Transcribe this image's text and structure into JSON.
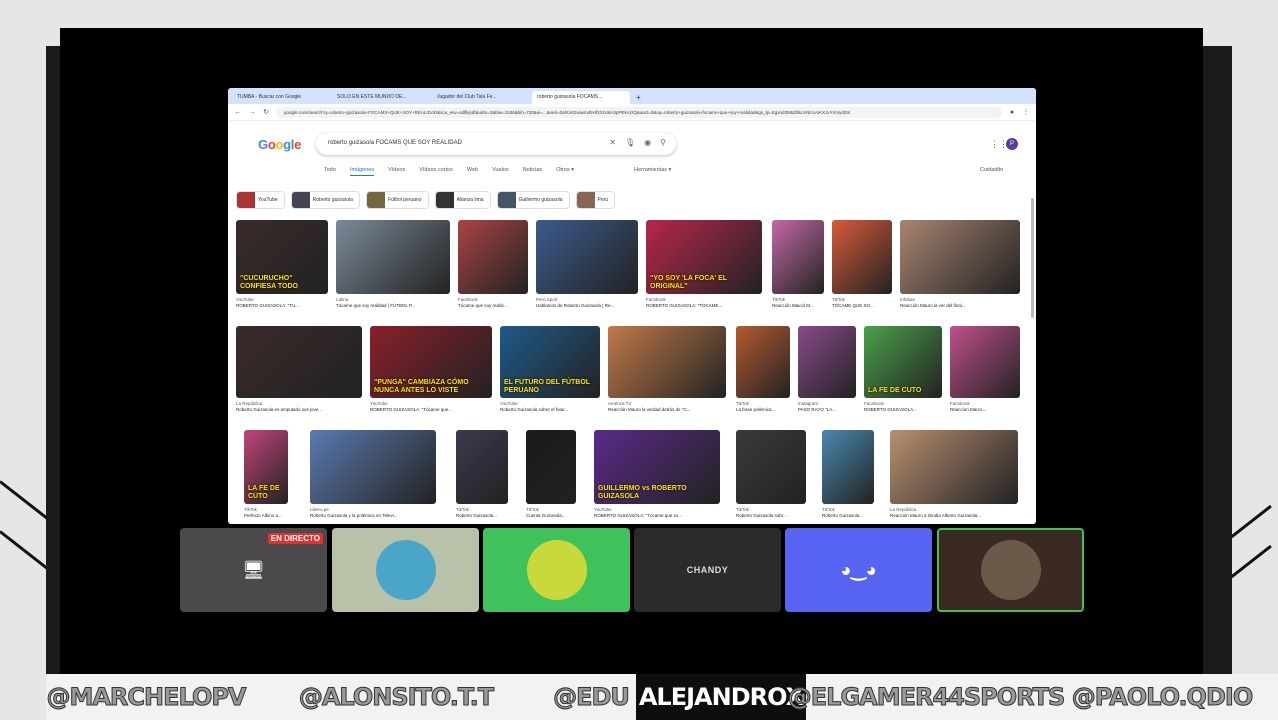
{
  "browser": {
    "tabs": [
      {
        "label": "TUMBA - Buscar con Google",
        "active": false
      },
      {
        "label": "SOLO EN ESTE MUNDO DE...",
        "active": false
      },
      {
        "label": "Jugador del Club Tala Fe...",
        "active": false
      },
      {
        "label": "roberto guizasola FOCAMS...",
        "active": true
      }
    ],
    "url": "google.com/search?q=roberto+guizasola+FOCAMS+QUE+SOY+REALIDAD&sca_esv=sdlfkjsdf&udm=2&biw=1536&bih=730&ei=...&ved=0ahUKEwiwmd5Hf2h3U6A3pPEkAOQ&uact=5&oq=roberto+guizasola+focams+que+soy+realidad&gs_lp=Egxnd3Mtd2l6LXNlcnAiKXJvYmVydG8",
    "tab_plus": "+"
  },
  "google": {
    "logo": [
      "G",
      "o",
      "o",
      "g",
      "l",
      "e"
    ],
    "logo_colors": [
      "#4285f4",
      "#ea4335",
      "#fbbc05",
      "#4285f4",
      "#34a853",
      "#ea4335"
    ],
    "query": "roberto guizasola FOCAMS QUE SOY REALIDAD",
    "tabs": [
      "Todo",
      "Imágenes",
      "Vídeos",
      "Vídeos cortos",
      "Web",
      "Vuelos",
      "Noticias",
      "Otros ▾"
    ],
    "tools": "Herramientas ▾",
    "safe_search": "Cuidadito",
    "avatar_letter": "P",
    "chips": [
      {
        "label": "YouTube",
        "color": "#a33"
      },
      {
        "label": "Roberto guizasola",
        "color": "#445"
      },
      {
        "label": "Fútbol peruano",
        "color": "#764"
      },
      {
        "label": "Alianza lima",
        "color": "#333"
      },
      {
        "label": "Guillermo guizasola",
        "color": "#456"
      },
      {
        "label": "Perú",
        "color": "#865"
      }
    ]
  },
  "results": {
    "row1": [
      {
        "src": "YouTube",
        "title": "ROBERTO GUIZASOLA: \"TU...",
        "caption": "\"CUCURUCHO\" CONFIESA TODO",
        "color": "#3a2b2b"
      },
      {
        "src": "Latina",
        "title": "Tócame que soy realidad | FÚTBOL P...",
        "caption": "",
        "color": "#7b8a99"
      },
      {
        "src": "Facebook",
        "title": "Tócame que soy realid...",
        "caption": "",
        "color": "#a44"
      },
      {
        "src": "Perú Sport",
        "title": "Hablamos de Roberto Guizasola | Re...",
        "caption": "",
        "color": "#3b5b8c"
      },
      {
        "src": "Facebook",
        "title": "ROBERTO GUIZASOLA: \"TÓCAME...",
        "caption": "\"YO SOY 'LA FOCA' EL ORIGINAL\"",
        "color": "#b7264b"
      },
      {
        "src": "TikTok",
        "title": "Reacción Maicol M...",
        "caption": "",
        "color": "#c46aa8"
      },
      {
        "src": "TikTok",
        "title": "TÓCAME QUE SO...",
        "caption": "",
        "color": "#d85a3a"
      },
      {
        "src": "Infobae",
        "title": "Reacción Mauro la ver del final...",
        "caption": "",
        "color": "#a88570"
      }
    ],
    "row2": [
      {
        "src": "La República",
        "title": "Roberto Guizasola es amputado sus jove...",
        "caption": "",
        "color": "#3a2a2a"
      },
      {
        "src": "YouTube",
        "title": "ROBERTO GUIZASOLA: \"Tócame que...",
        "caption": "\"PUNGA\" CAMBIAZA CÓMO NUNCA ANTES LO VISTE",
        "color": "#8a1f2a"
      },
      {
        "src": "YouTube",
        "title": "Roberto Guizasola sobre el futur...",
        "caption": "EL FUTURO DEL FÚTBOL PERUANO",
        "color": "#1f5a88"
      },
      {
        "src": "América TV",
        "title": "Reacción Mauro la verdad detrás de \"C...",
        "caption": "",
        "color": "#c27a4a"
      },
      {
        "src": "TikTok",
        "title": "La frase polémica...",
        "caption": "",
        "color": "#b55a30"
      },
      {
        "src": "Instagram",
        "title": "PASO RAYO \"LA...",
        "caption": "",
        "color": "#8a4a8c"
      },
      {
        "src": "Facebook",
        "title": "ROBERTO GUIZASOLA...",
        "caption": "LA FE DE CUTO",
        "color": "#4aa04a"
      },
      {
        "src": "Facebook",
        "title": "Reaccion Marco...",
        "caption": "",
        "color": "#c0508c"
      }
    ],
    "row3": [
      {
        "src": "TikTok",
        "title": "Perfecto Albino a...",
        "caption": "LA FE DE CUTO",
        "color": "#c2457a"
      },
      {
        "src": "Libero.pe",
        "title": "Roberto Guizasola y la polémica en Televi...",
        "caption": "",
        "color": "#5a7ab0"
      },
      {
        "src": "TikTok",
        "title": "Roberto Guizasola...",
        "caption": "",
        "color": "#3a3a50"
      },
      {
        "src": "TikTok",
        "title": "Cuenta Guizasola...",
        "caption": "",
        "color": "#1a1a1a"
      },
      {
        "src": "YouTube",
        "title": "ROBERTO GUIZASOLA: \"Tócame que so...",
        "caption": "GUILLERMO vs ROBERTO GUIZASOLA",
        "color": "#5a2a8a"
      },
      {
        "src": "TikTok",
        "title": "Roberto Guizasola sobr...",
        "caption": "",
        "color": "#3a3a3a"
      },
      {
        "src": "TikTok",
        "title": "Roberto Guizasola...",
        "caption": "",
        "color": "#4a88b0"
      },
      {
        "src": "La República",
        "title": "Reacción Mauro a Gindia Alberto Guizasola...",
        "caption": "",
        "color": "#b89070"
      }
    ]
  },
  "participants": [
    {
      "label": "",
      "badge": "EN DIRECTO",
      "kind": "screen",
      "bg": "#4a4a4a"
    },
    {
      "label": "",
      "badge": "",
      "kind": "avatar",
      "bg": "#b7c2a8",
      "avatar": "#4aa6c8"
    },
    {
      "label": "",
      "badge": "",
      "kind": "avatar",
      "bg": "#3fc15c",
      "avatar": "#c9d93b"
    },
    {
      "label": "CHANDY",
      "badge": "",
      "kind": "name",
      "bg": "#2b2b2b"
    },
    {
      "label": "",
      "badge": "",
      "kind": "discord",
      "bg": "#5865f2"
    },
    {
      "label": "",
      "badge": "",
      "kind": "avatar",
      "bg": "#3a2a22",
      "avatar": "#6b5a4a"
    }
  ],
  "names_bar": [
    "@MARCHELOPV",
    "@ALONSITO.T.T",
    "@EDU",
    "ALEJANDROX",
    "@ELGAMER44SPORTS",
    "@PAOLO.QDIO"
  ],
  "colors": {
    "accent": "#1a73e8",
    "live": "#e03131",
    "discord": "#5865f2"
  }
}
